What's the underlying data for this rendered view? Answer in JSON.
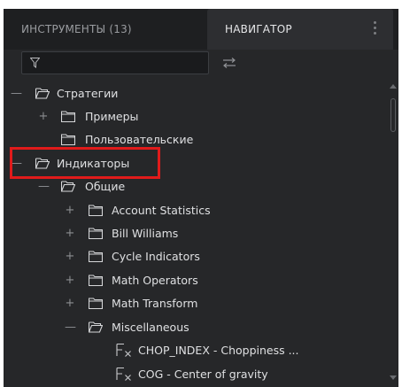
{
  "tabs": {
    "instruments": "ИНСТРУМЕНТЫ (13)",
    "navigator": "НАВИГАТОР"
  },
  "filter": {
    "value": "",
    "placeholder": ""
  },
  "tree": {
    "strategies": "Стратегии",
    "examples": "Примеры",
    "custom": "Пользовательские",
    "indicators": "Индикаторы",
    "general": "Общие",
    "account_statistics": "Account Statistics",
    "bill_williams": "Bill Williams",
    "cycle_indicators": "Cycle Indicators",
    "math_operators": "Math Operators",
    "math_transform": "Math Transform",
    "miscellaneous": "Miscellaneous",
    "chop_index": "CHOP_INDEX - Choppiness ...",
    "cog": "COG - Center of gravity"
  },
  "colors": {
    "highlight": "#e01b1b",
    "panel": "#262729",
    "tab_bar": "#1e1f21"
  }
}
